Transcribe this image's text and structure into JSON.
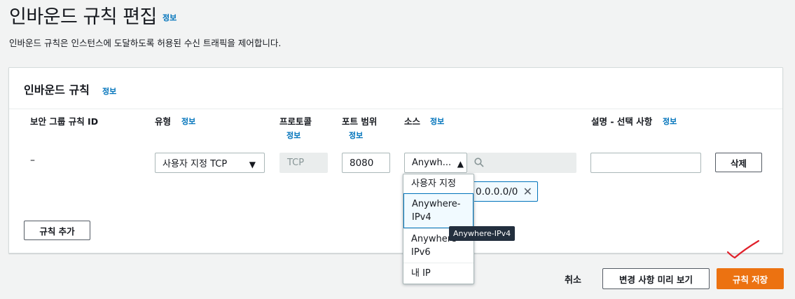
{
  "page": {
    "title": "인바운드 규칙 편집",
    "info": "정보",
    "description": "인바운드 규칙은 인스턴스에 도달하도록 허용된 수신 트래픽을 제어합니다."
  },
  "panel": {
    "title": "인바운드 규칙",
    "info": "정보",
    "columns": {
      "rule_id": "보안 그룹 규칙 ID",
      "type": "유형",
      "protocol": "프로토콜",
      "port_range": "포트 범위",
      "source": "소스",
      "description": "설명 - 선택 사항",
      "info": "정보"
    },
    "row": {
      "rule_id": "–",
      "type": "사용자 지정 TCP",
      "protocol": "TCP",
      "port": "8080",
      "source_type": "Anywh...",
      "source_token": "0.0.0.0/0",
      "description": "",
      "delete": "삭제"
    },
    "add_rule": "규칙 추가"
  },
  "source_dropdown": {
    "options": [
      {
        "label": "사용자 지정",
        "selected": false
      },
      {
        "label": "Anywhere-\nIPv4",
        "selected": true
      },
      {
        "label": "Anywhere-\nIPv6",
        "selected": false
      },
      {
        "label": "내 IP",
        "selected": false
      }
    ]
  },
  "tooltip": "Anywhere-IPv4",
  "footer": {
    "cancel": "취소",
    "preview": "변경 사항 미리 보기",
    "save": "규칙 저장"
  },
  "colors": {
    "accent": "#ec7211",
    "link": "#0073bb",
    "annotation": "#e0202a"
  },
  "icons": {
    "type_caret": "caret-down-icon",
    "source_caret": "caret-up-icon",
    "search": "search-icon",
    "remove_token": "close-icon"
  }
}
